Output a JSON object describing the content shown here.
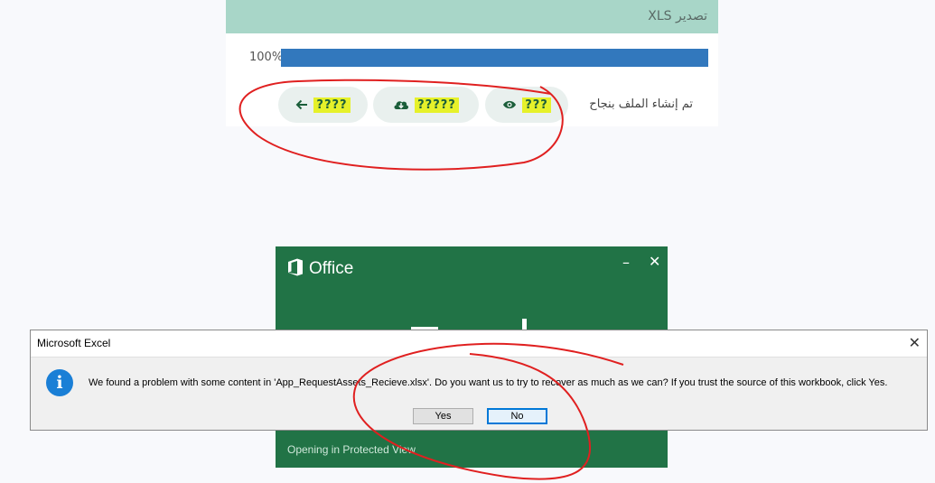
{
  "export_panel": {
    "title": "تصدير XLS",
    "progress": {
      "percent_label": "100%",
      "value": 1.0
    },
    "status_text": "تم إنشاء الملف بنجاح",
    "buttons": {
      "view": {
        "label": "???",
        "icon": "eye-icon"
      },
      "download": {
        "label": "?????",
        "icon": "cloud-download-icon"
      },
      "back": {
        "label": "????",
        "icon": "arrow-left-icon"
      }
    }
  },
  "office_splash": {
    "brand": "Office",
    "minimize_glyph": "–",
    "close_glyph": "✕",
    "status": "Opening in Protected View"
  },
  "excel_dialog": {
    "title": "Microsoft Excel",
    "close_glyph": "✕",
    "icon": "info-icon",
    "icon_glyph": "i",
    "message": "We found a problem with some content in 'App_RequestAssets_Recieve.xlsx'. Do you want us to try to recover as much as we can? If you trust the source of this workbook, click Yes.",
    "yes_label": "Yes",
    "no_label": "No"
  },
  "colors": {
    "header_bg": "#a8d6c8",
    "progress_fill": "#3278bd",
    "office_green": "#217346",
    "highlight": "#e6f12a",
    "annotation_red": "#e02020",
    "info_blue": "#1a7fd6"
  }
}
